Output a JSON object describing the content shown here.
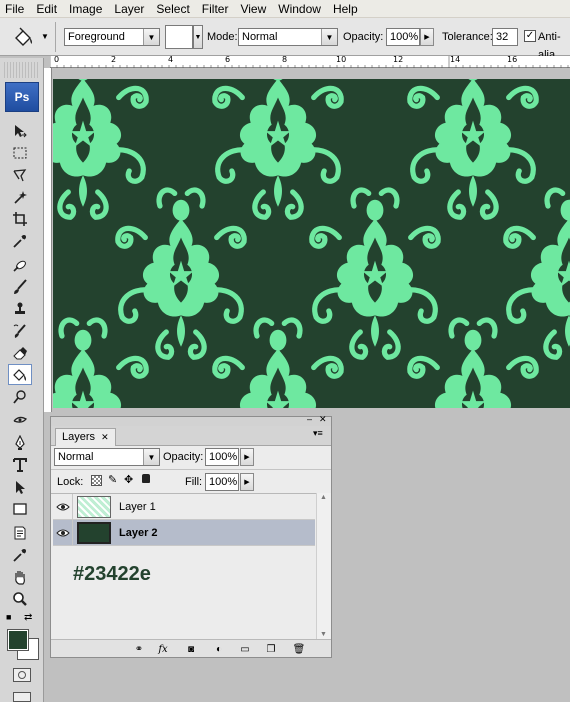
{
  "menubar": {
    "items": [
      "File",
      "Edit",
      "Image",
      "Layer",
      "Select",
      "Filter",
      "View",
      "Window",
      "Help"
    ]
  },
  "options_bar": {
    "fill_source": "Foreground",
    "mode_label": "Mode:",
    "mode_value": "Normal",
    "opacity_label": "Opacity:",
    "opacity_value": "100%",
    "tolerance_label": "Tolerance:",
    "tolerance_value": "32",
    "antialias_label": "Anti-alia",
    "antialias_checked": true
  },
  "ruler": {
    "top_labels": [
      "0",
      "2",
      "4",
      "6",
      "8",
      "10",
      "12",
      "14",
      "16"
    ]
  },
  "toolbox": {
    "logo": "Ps",
    "foreground_color": "#23422e",
    "background_color": "#ffffff",
    "active_tool": "paint-bucket-tool"
  },
  "canvas": {
    "background_color": "#23422e",
    "pattern_color": "#6ee8a0"
  },
  "layers_panel": {
    "tab_label": "Layers",
    "blend_mode": "Normal",
    "opacity_label": "Opacity:",
    "opacity_value": "100%",
    "lock_label": "Lock:",
    "fill_label": "Fill:",
    "fill_value": "100%",
    "layers": [
      {
        "name": "Layer 1",
        "selected": false
      },
      {
        "name": "Layer 2",
        "selected": true
      }
    ],
    "annotation": "#23422e"
  }
}
